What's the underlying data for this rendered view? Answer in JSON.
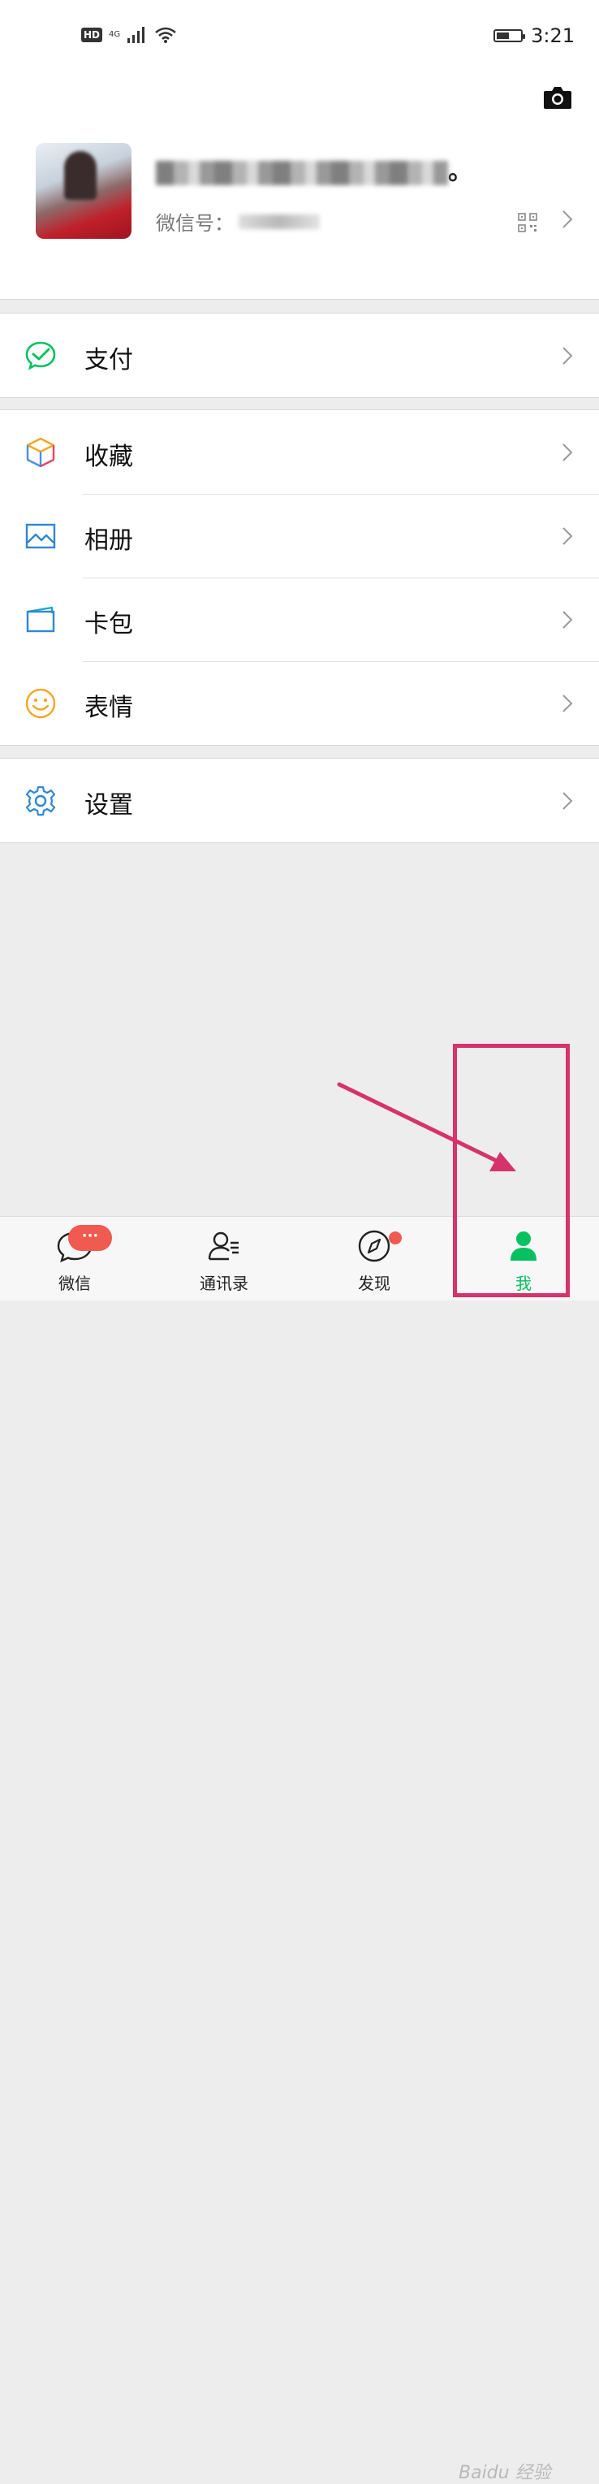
{
  "status_bar": {
    "hd_label": "HD",
    "network_label": "4G",
    "time": "3:21",
    "battery_level": 0.55
  },
  "profile": {
    "nickname_suffix": "。",
    "wechat_id_label": "微信号："
  },
  "menu": {
    "group1": [
      {
        "label": "支付",
        "icon": "pay-icon"
      }
    ],
    "group2": [
      {
        "label": "收藏",
        "icon": "favorites-icon"
      },
      {
        "label": "相册",
        "icon": "album-icon"
      },
      {
        "label": "卡包",
        "icon": "card-wallet-icon"
      },
      {
        "label": "表情",
        "icon": "sticker-icon"
      }
    ],
    "group3": [
      {
        "label": "设置",
        "icon": "settings-icon"
      }
    ]
  },
  "tabbar": {
    "tabs": [
      {
        "label": "微信",
        "badge": "···"
      },
      {
        "label": "通讯录"
      },
      {
        "label": "发现",
        "has_dot": true
      },
      {
        "label": "我",
        "active": true
      }
    ]
  },
  "colors": {
    "accent_green": "#07c160",
    "badge_red": "#f05a50",
    "annotation_pink": "#d6336c"
  },
  "watermark": "Baidu 经验"
}
